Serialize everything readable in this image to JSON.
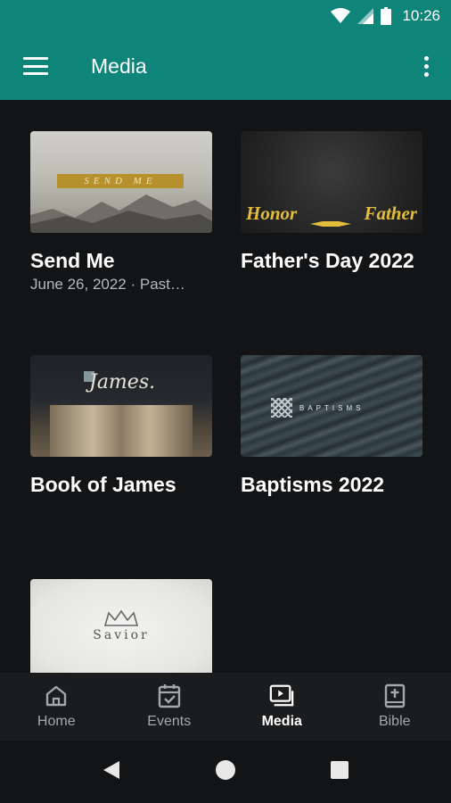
{
  "status_bar": {
    "time": "10:26",
    "icons": [
      "wifi-icon",
      "signal-icon",
      "battery-icon"
    ]
  },
  "app_bar": {
    "title": "Media",
    "menu_icon": "hamburger-menu-icon",
    "overflow_icon": "more-vert-icon"
  },
  "colors": {
    "accent": "#0f857a",
    "background": "#121416",
    "nav_background": "#1a1c1e",
    "subtext": "#b5b8bb",
    "inactive": "#a4a8ab"
  },
  "media_items": [
    {
      "title": "Send Me",
      "subtitle": "June 26, 2022 · Past…",
      "thumb_text": "SEND ME"
    },
    {
      "title": "Father's Day 2022",
      "subtitle": "",
      "thumb_text_left": "Honor",
      "thumb_text_right": "Father"
    },
    {
      "title": "Book of James",
      "subtitle": "",
      "thumb_text": "James."
    },
    {
      "title": "Baptisms 2022",
      "subtitle": "",
      "thumb_text": "BAPTISMS"
    },
    {
      "title": "",
      "subtitle": "",
      "thumb_text": "Savior"
    }
  ],
  "bottom_nav": [
    {
      "label": "Home",
      "icon": "home-icon",
      "active": false
    },
    {
      "label": "Events",
      "icon": "calendar-check-icon",
      "active": false
    },
    {
      "label": "Media",
      "icon": "video-library-icon",
      "active": true
    },
    {
      "label": "Bible",
      "icon": "bible-icon",
      "active": false
    }
  ],
  "system_nav": [
    "back-icon",
    "home-circle-icon",
    "recents-icon"
  ]
}
